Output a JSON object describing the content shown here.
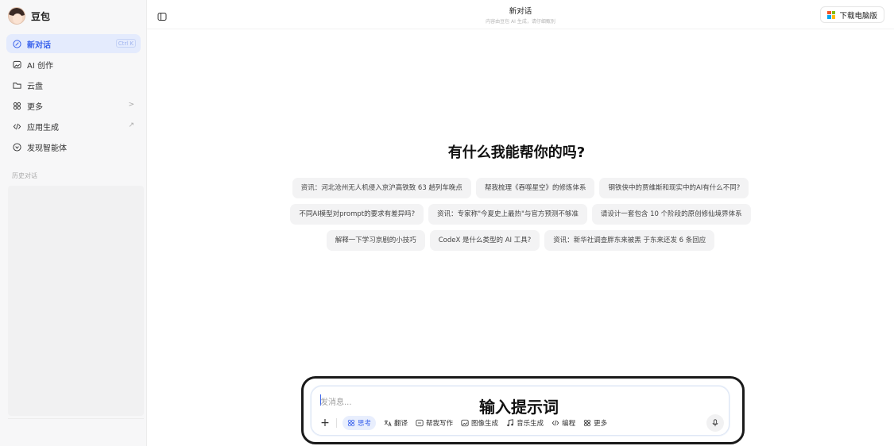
{
  "app": {
    "name": "豆包"
  },
  "sidebar": {
    "items": [
      {
        "label": "新对话",
        "shortcut": "Ctrl K",
        "icon": "new-chat-icon",
        "active": true
      },
      {
        "label": "AI 创作",
        "icon": "image-icon"
      },
      {
        "label": "云盘",
        "icon": "folder-icon"
      },
      {
        "label": "更多",
        "icon": "grid-icon",
        "trail": ">"
      },
      {
        "label": "应用生成",
        "icon": "code-icon",
        "trail": "↗"
      },
      {
        "label": "发现智能体",
        "icon": "compass-icon"
      }
    ],
    "history_title": "历史对话"
  },
  "topbar": {
    "title": "新对话",
    "subtitle": "内容由豆包 AI 生成，请仔细甄别",
    "download_label": "下载电脑版"
  },
  "main": {
    "heading": "有什么我能帮你的吗?",
    "suggestions": [
      [
        "资讯：河北沧州无人机侵入京沪高铁致 63 趟列车晚点",
        "帮我梳理《吞噬星空》的修炼体系",
        "钢铁侠中的贾维斯和现实中的AI有什么不同?"
      ],
      [
        "不同AI模型对prompt的要求有差异吗?",
        "资讯：专家称\"今夏史上最热\"与官方预测不够准",
        "请设计一套包含 10 个阶段的原创修仙境界体系"
      ],
      [
        "解释一下学习京剧的小技巧",
        "CodeX 是什么类型的 AI 工具?",
        "资讯：新华社调查胖东来被黑 于东来还发 6 条回应"
      ]
    ]
  },
  "composer": {
    "placeholder": "发消息...",
    "overlay_label": "输入提示词",
    "tools": [
      {
        "label": "思考",
        "icon": "think-icon",
        "active": true
      },
      {
        "label": "翻译",
        "icon": "translate-icon"
      },
      {
        "label": "帮我写作",
        "icon": "write-icon"
      },
      {
        "label": "图像生成",
        "icon": "image-gen-icon"
      },
      {
        "label": "音乐生成",
        "icon": "music-icon"
      },
      {
        "label": "编程",
        "icon": "code-icon"
      },
      {
        "label": "更多",
        "icon": "more-grid-icon"
      }
    ]
  },
  "colors": {
    "accent": "#3a63ec",
    "active_bg": "#e4ebfd",
    "chip_bg": "#f3f3f4",
    "sidebar_bg": "#f7f7f8"
  }
}
